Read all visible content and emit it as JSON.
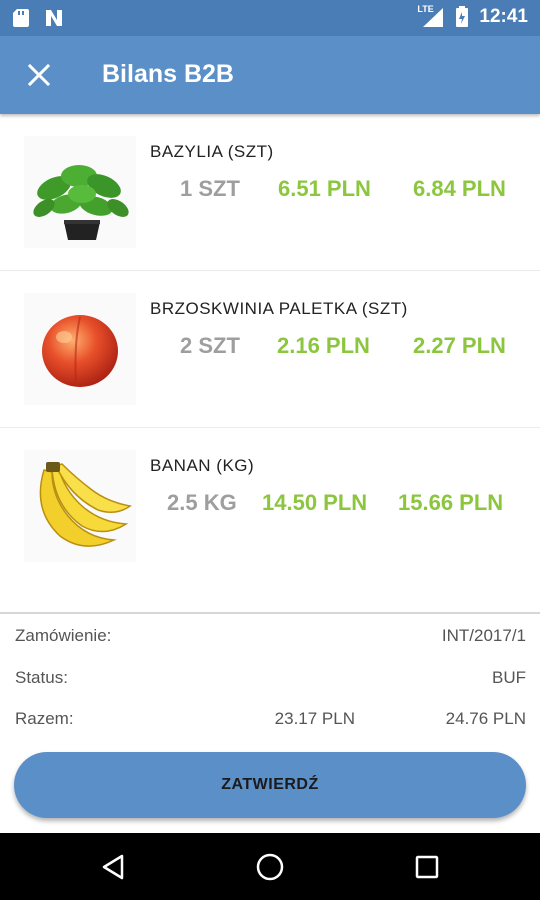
{
  "status_bar": {
    "network": "LTE",
    "time": "12:41"
  },
  "app_bar": {
    "title": "Bilans B2B",
    "close_icon": "close-icon"
  },
  "products": [
    {
      "name": "BAZYLIA (SZT)",
      "quantity": "1 SZT",
      "price_net": "6.51 PLN",
      "price_gross": "6.84 PLN",
      "image": "basil-icon"
    },
    {
      "name": "BRZOSKWINIA PALETKA (SZT)",
      "quantity": "2 SZT",
      "price_net": "2.16 PLN",
      "price_gross": "2.27 PLN",
      "image": "peach-icon"
    },
    {
      "name": "BANAN (KG)",
      "quantity": "2.5 KG",
      "price_net": "14.50 PLN",
      "price_gross": "15.66 PLN",
      "image": "banana-icon"
    }
  ],
  "summary": {
    "order_label": "Zamówienie:",
    "order_value": "INT/2017/1",
    "status_label": "Status:",
    "status_value": "BUF",
    "total_label": "Razem:",
    "total_net": "23.17 PLN",
    "total_gross": "24.76 PLN"
  },
  "confirm_button": "ZATWIERDŹ",
  "colors": {
    "primary": "#5b8fc8",
    "status_bar": "#4a7db5",
    "price": "#8cc63f",
    "quantity": "#9e9e9e"
  }
}
